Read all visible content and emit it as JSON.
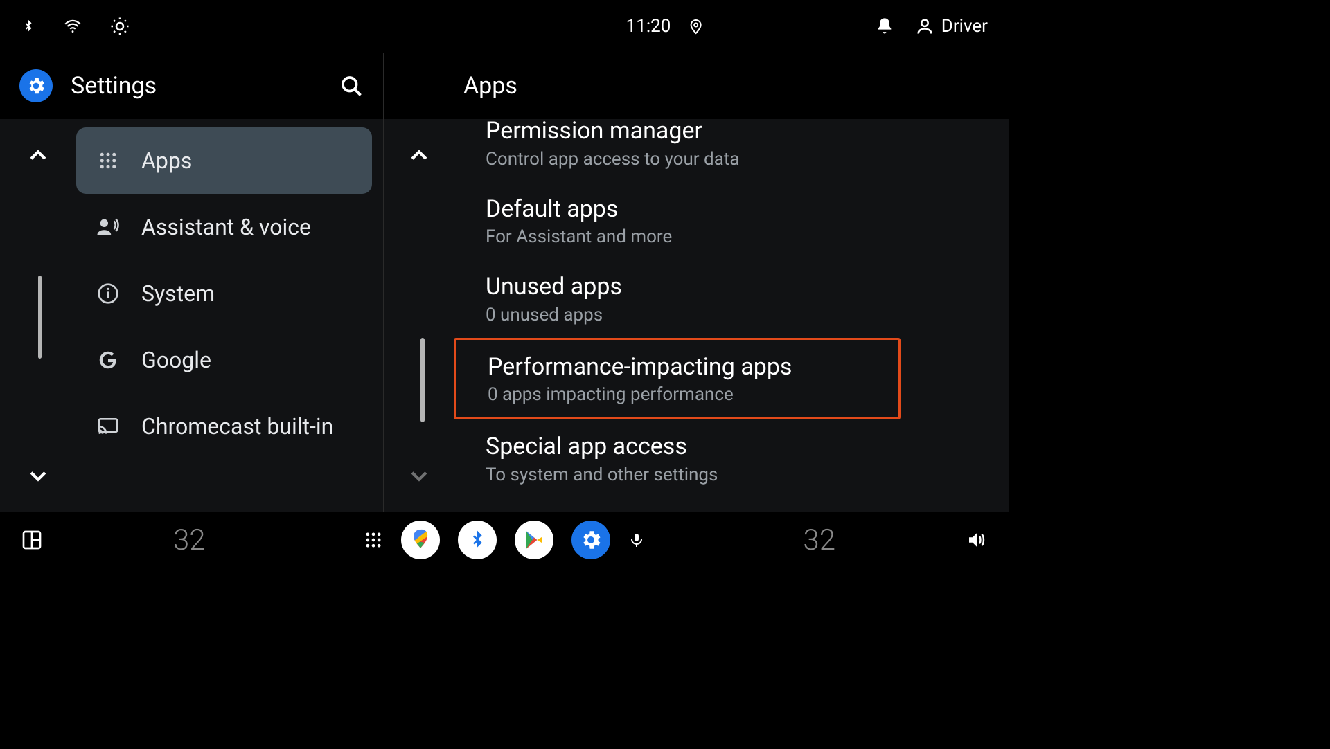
{
  "status": {
    "time": "11:20",
    "user": "Driver"
  },
  "left": {
    "title": "Settings",
    "items": [
      {
        "label": "Apps",
        "icon": "apps"
      },
      {
        "label": "Assistant & voice",
        "icon": "assistant"
      },
      {
        "label": "System",
        "icon": "info"
      },
      {
        "label": "Google",
        "icon": "google"
      },
      {
        "label": "Chromecast built-in",
        "icon": "cast"
      }
    ]
  },
  "right": {
    "title": "Apps",
    "items": [
      {
        "title": "Permission manager",
        "sub": "Control app access to your data"
      },
      {
        "title": "Default apps",
        "sub": "For Assistant and more"
      },
      {
        "title": "Unused apps",
        "sub": "0 unused apps"
      },
      {
        "title": "Performance-impacting apps",
        "sub": "0 apps impacting performance"
      },
      {
        "title": "Special app access",
        "sub": "To system and other settings"
      }
    ]
  },
  "navbar": {
    "temp_left": "32",
    "temp_right": "32"
  }
}
